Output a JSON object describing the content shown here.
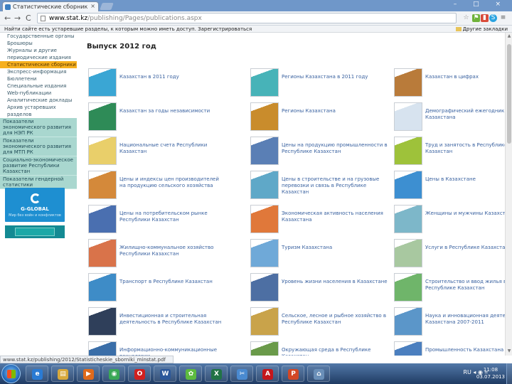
{
  "browser": {
    "tab_title": "Статистические сборник",
    "tab_close": "×",
    "window_controls": "– □ ×",
    "back": "←",
    "forward": "→",
    "reload": "C",
    "url_host": "www.stat.kz",
    "url_path": "/publishing/Pages/publications.aspx",
    "infobar_text": "Найти сайте есть устаревшие разделы, к которым можно иметь доступ. Зарегистрироваться",
    "bookmarks_label": "Другие закладки",
    "status_url": "www.stat.kz/publishing/2012/Statisticheskie_sborniki_minstat.pdf"
  },
  "sidebar": {
    "items": [
      "Государственные органы",
      "Брошюры",
      "Журналы и другие",
      "периодические издания",
      "Статистические сборники",
      "Экспресс-информация",
      "Бюллетени",
      "Специальные издания",
      "Web-публикации",
      "Аналитические доклады",
      "Архив устаревших",
      "разделов"
    ],
    "active_index": 4,
    "blocks": [
      "Показатели экономического развития для НЭП РК",
      "Показатели экономического развития для МТП РК",
      "Социально-экономическое развитие Республики Казахстан",
      "Показатели гендерной статистики"
    ],
    "banner_name": "G-GLOBAL",
    "banner_sub": "Мир без войн и конфликтов"
  },
  "main": {
    "heading": "Выпуск 2012 год",
    "publications": [
      {
        "title": "Казахстан в 2011 году",
        "color": "#3aa6d4"
      },
      {
        "title": "Регионы Казахстана в 2011 году",
        "color": "#47b3b8"
      },
      {
        "title": "Казахстан в цифрах",
        "color": "#b97b3a"
      },
      {
        "title": "Казахстан за годы независимости",
        "color": "#2e8b57"
      },
      {
        "title": "Регионы Казахстана",
        "color": "#c98c2c"
      },
      {
        "title": "Демографический ежегодник Казахстана",
        "color": "#d7e3ef"
      },
      {
        "title": "Национальные счета Республики Казахстан",
        "color": "#e9cf6a"
      },
      {
        "title": "Цены на продукцию промышленности в Республике Казахстан",
        "color": "#5a7fb5"
      },
      {
        "title": "Труд и занятость в Республике Казахстан",
        "color": "#9ec23a"
      },
      {
        "title": "Цены и индексы цен производителей на продукцию сельского хозяйства",
        "color": "#d4893a"
      },
      {
        "title": "Цены в строительстве и на грузовые перевозки и связь в Республике Казахстан",
        "color": "#5fa8c8"
      },
      {
        "title": "Цены в Казахстане",
        "color": "#3d8fd1"
      },
      {
        "title": "Цены на потребительском рынке Республики Казахстан",
        "color": "#4a6fb0"
      },
      {
        "title": "Экономическая активность населения Казахстана",
        "color": "#e0783a"
      },
      {
        "title": "Женщины и мужчины Казахстана",
        "color": "#7db7c9"
      },
      {
        "title": "Жилищно-коммунальное хозяйство Республики Казахстан",
        "color": "#d9734a"
      },
      {
        "title": "Туризм Казахстана",
        "color": "#6fa9d8"
      },
      {
        "title": "Услуги в Республике Казахстан",
        "color": "#a8c8a0"
      },
      {
        "title": "Транспорт в Республике Казахстан",
        "color": "#3e8cc7"
      },
      {
        "title": "Уровень жизни населения в Казахстане",
        "color": "#4d6fa3"
      },
      {
        "title": "Строительство и ввод жилья в Республике Казахстан",
        "color": "#6fb56a"
      },
      {
        "title": "Инвестиционная и строительная деятельность в Республике Казахстан",
        "color": "#2f3f5a"
      },
      {
        "title": "Сельское, лесное и рыбное хозяйство в Республике Казахстан",
        "color": "#c9a34a"
      },
      {
        "title": "Наука и инновационная деятельность Казахстана 2007-2011",
        "color": "#5b96c9"
      },
      {
        "title": "Информационно-коммуникационные технологии",
        "color": "#3a6ea8"
      },
      {
        "title": "Окружающая среда в Республике Казахстан",
        "color": "#6a9a4a"
      },
      {
        "title": "Промышленность Казахстана",
        "color": "#4b7fbf"
      }
    ]
  },
  "taskbar": {
    "apps": [
      {
        "name": "Internet Explorer",
        "glyph": "e",
        "color": "#2a7bd4"
      },
      {
        "name": "Explorer",
        "glyph": "▤",
        "color": "#d7a93c"
      },
      {
        "name": "Media Player",
        "glyph": "▶",
        "color": "#e06a1b"
      },
      {
        "name": "Chrome",
        "glyph": "◉",
        "color": "#3aa757"
      },
      {
        "name": "Opera",
        "glyph": "O",
        "color": "#d0201f"
      },
      {
        "name": "Word",
        "glyph": "W",
        "color": "#2b579a"
      },
      {
        "name": "ICQ",
        "glyph": "✿",
        "color": "#5dbb3f"
      },
      {
        "name": "Excel",
        "glyph": "X",
        "color": "#217346"
      },
      {
        "name": "Tool",
        "glyph": "✂",
        "color": "#4a8ad0"
      },
      {
        "name": "Adobe Reader",
        "glyph": "A",
        "color": "#c4161c"
      },
      {
        "name": "PowerPoint",
        "glyph": "P",
        "color": "#d24726"
      },
      {
        "name": "Network",
        "glyph": "⌂",
        "color": "#6a8fb8"
      }
    ],
    "tray": "RU  ◂  ◉  ⌗",
    "time": "11:08",
    "date": "03.07.2013"
  }
}
